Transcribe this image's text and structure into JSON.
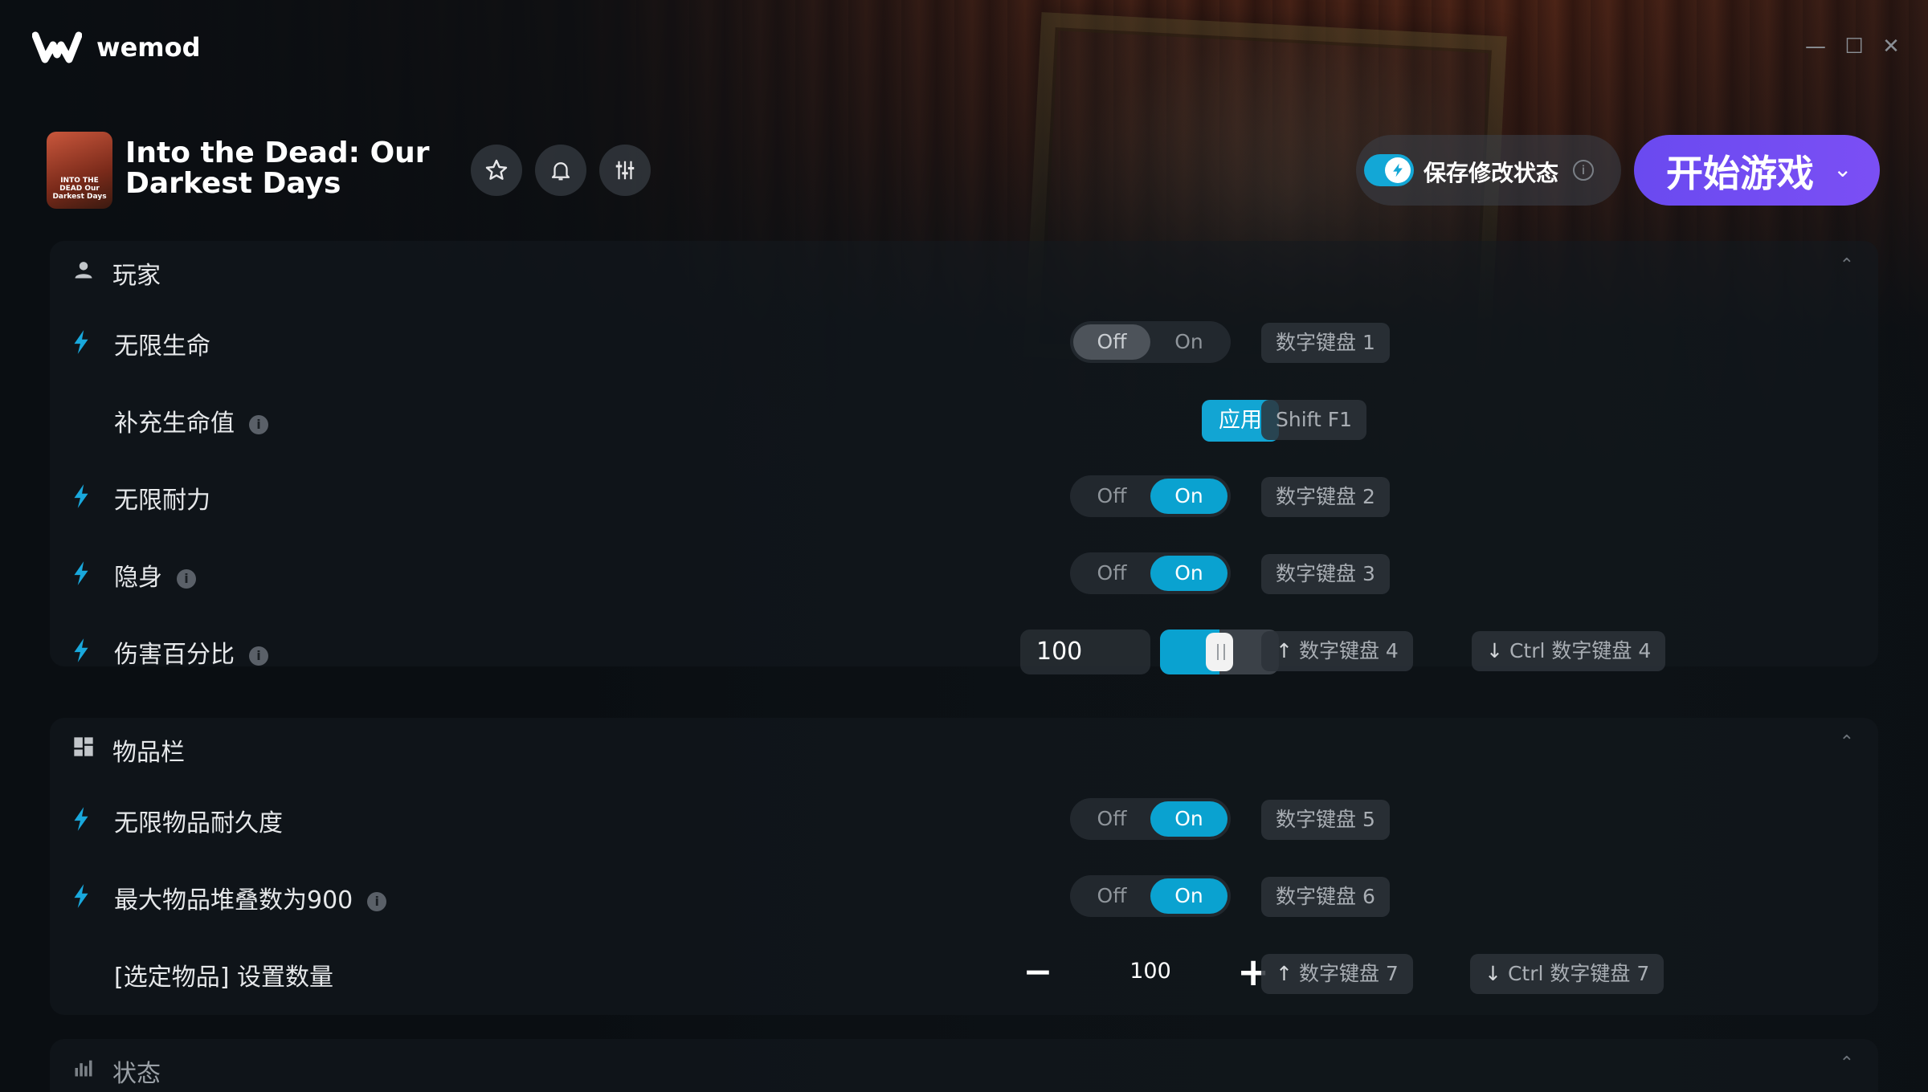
{
  "app": {
    "brand": "wemod",
    "window_controls": {
      "minimize": "—",
      "maximize": "☐",
      "close": "✕"
    }
  },
  "game": {
    "title": "Into the Dead: Our Darkest Days",
    "cover_text": "INTO THE DEAD Our Darkest Days",
    "favorite_icon": "star-icon",
    "notify_icon": "bell-icon",
    "settings_icon": "sliders-icon"
  },
  "save_mods": {
    "label": "保存修改状态",
    "info": "i",
    "enabled": true
  },
  "play": {
    "label": "开始游戏",
    "chevron": "⌄"
  },
  "accent_color": "#0aa2d0",
  "play_color": "#7050f2",
  "sections": {
    "player": {
      "label": "玩家",
      "chevron": "⌃",
      "rows": {
        "infinite_health": {
          "label": "无限生命",
          "off": "Off",
          "on": "On",
          "state": "off",
          "hotkey": "数字键盘 1"
        },
        "refill_health": {
          "label": "补充生命值",
          "info": "i",
          "apply": "应用",
          "hotkey": "Shift F1"
        },
        "infinite_stamina": {
          "label": "无限耐力",
          "off": "Off",
          "on": "On",
          "state": "on",
          "hotkey": "数字键盘 2"
        },
        "stealth": {
          "label": "隐身",
          "info": "i",
          "off": "Off",
          "on": "On",
          "state": "on",
          "hotkey": "数字键盘 3"
        },
        "damage_percent": {
          "label": "伤害百分比",
          "info": "i",
          "value": "100",
          "slider_fraction": 0.5,
          "hotkey_up": "数字键盘 4",
          "hotkey_down": "Ctrl 数字键盘 4"
        }
      }
    },
    "inventory": {
      "label": "物品栏",
      "chevron": "⌃",
      "rows": {
        "infinite_durability": {
          "label": "无限物品耐久度",
          "off": "Off",
          "on": "On",
          "state": "on",
          "hotkey": "数字键盘 5"
        },
        "max_stack": {
          "label": "最大物品堆叠数为900",
          "info": "i",
          "off": "Off",
          "on": "On",
          "state": "on",
          "hotkey": "数字键盘 6"
        },
        "set_quantity": {
          "label": "[选定物品] 设置数量",
          "minus": "−",
          "plus": "+",
          "value": "100",
          "hotkey_up": "数字键盘 7",
          "hotkey_down": "Ctrl 数字键盘 7"
        }
      }
    },
    "stats": {
      "label": "状态",
      "chevron": "⌃"
    }
  }
}
